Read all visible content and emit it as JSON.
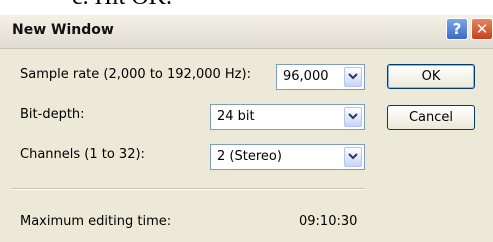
{
  "document": {
    "fragment_text": "c.   Hit OK."
  },
  "window": {
    "title": "New Window",
    "help_label": "?",
    "close_label": "✕"
  },
  "form": {
    "sample_rate": {
      "label": "Sample rate (2,000 to 192,000 Hz):",
      "value": "96,000"
    },
    "bit_depth": {
      "label": "Bit-depth:",
      "value": "24 bit"
    },
    "channels": {
      "label": "Channels (1 to 32):",
      "value": "2  (Stereo)"
    },
    "max_edit": {
      "label": "Maximum editing time:",
      "value": "09:10:30"
    }
  },
  "buttons": {
    "ok": "OK",
    "cancel": "Cancel"
  }
}
